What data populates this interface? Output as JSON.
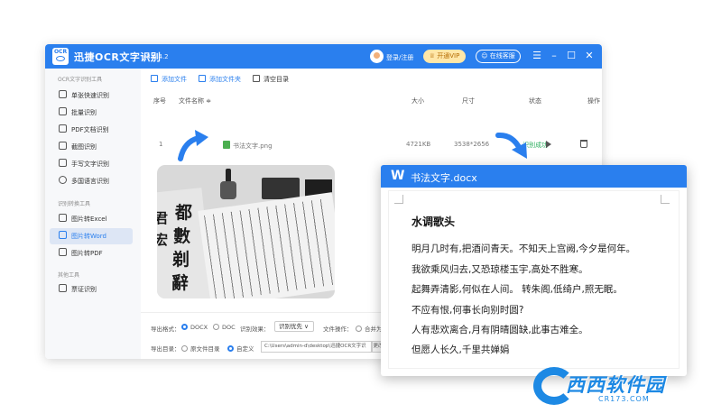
{
  "titlebar": {
    "logo_text": "OCR",
    "app_name": "迅捷OCR文字识别",
    "version": "v8.6.4.2",
    "login": "登录/注册",
    "vip": "开通VIP",
    "service": "在线客服"
  },
  "sidebar": {
    "group1": "OCR文字识别工具",
    "group2": "识别转换工具",
    "group3": "其他工具",
    "items": [
      {
        "label": "单张快速识别"
      },
      {
        "label": "批量识别"
      },
      {
        "label": "PDF文档识别"
      },
      {
        "label": "截图识别"
      },
      {
        "label": "手写文字识别"
      },
      {
        "label": "多国语言识别"
      },
      {
        "label": "图片转Excel"
      },
      {
        "label": "图片转Word"
      },
      {
        "label": "图片转PDF"
      },
      {
        "label": "票证识别"
      }
    ]
  },
  "toolbar": {
    "add_file": "添加文件",
    "add_folder": "添加文件夹",
    "clear": "清空目录"
  },
  "table": {
    "headers": {
      "index": "序号",
      "name": "文件名称 ≑",
      "size": "大小",
      "dimension": "尺寸",
      "status": "状态",
      "action": "操作",
      "delete": "删除"
    },
    "rows": [
      {
        "index": "1",
        "name": "书法文字.png",
        "size": "4721KB",
        "dimension": "3538*2656",
        "status": "✓ 识别成功"
      }
    ]
  },
  "footer": {
    "format_label": "导出格式：",
    "docx": "DOCX",
    "doc": "DOC",
    "effect_label": "识别效果：",
    "effect_value": "识别优先 ∨",
    "file_op_label": "文件操作：",
    "merge": "合并为",
    "dir_label": "导出目录：",
    "orig_dir": "原文件目录",
    "custom": "自定义",
    "path": "C:\\Users\\admin-d\\desktop\\迅捷OCR文字识",
    "change": "更改"
  },
  "doc": {
    "icon_letter": "W",
    "filename": "书法文字.docx",
    "title": "水调歌头",
    "lines": [
      "明月几时有,把酒问青天。不知天上宫阙,今夕是何年。",
      "我欲乘风归去,又恐琼楼玉宇,高处不胜寒。",
      "起舞弄清影,何似在人间。 转朱阁,低绮户,照无眠。",
      "不应有恨,何事长向别时圆?",
      "人有悲欢离合,月有阴晴圆缺,此事古难全。",
      "但愿人长久,千里共婵娟"
    ]
  },
  "photo": {
    "chars": [
      "都",
      "數",
      "剃",
      "辭",
      "君",
      "宏"
    ]
  },
  "watermark": {
    "text": "西西软件园",
    "url": "CR173.COM"
  },
  "colors": {
    "accent": "#2a7fee",
    "success": "#2dae5f",
    "vip": "#ffe7a8"
  }
}
